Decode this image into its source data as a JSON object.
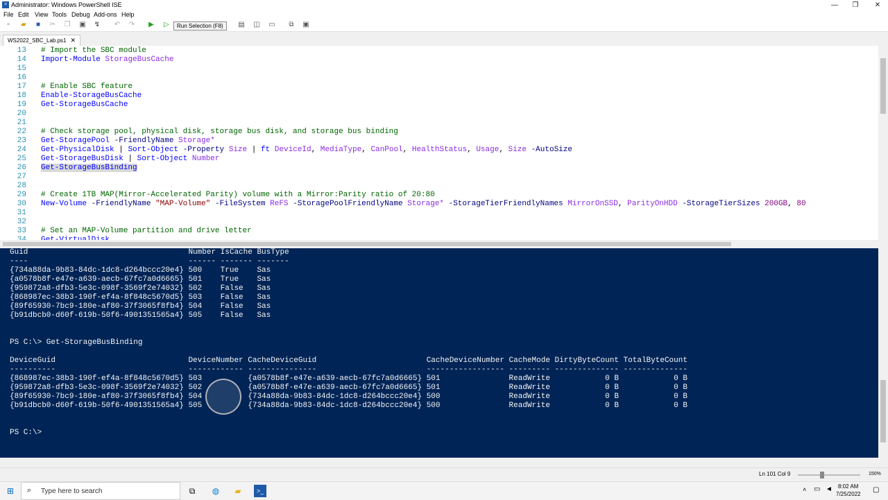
{
  "window": {
    "title": "Administrator: Windows PowerShell ISE",
    "minimize": "—",
    "restore": "❐",
    "close": "✕"
  },
  "menu": [
    "File",
    "Edit",
    "View",
    "Tools",
    "Debug",
    "Add-ons",
    "Help"
  ],
  "toolbar": {
    "tooltip": "Run Selection (F8)"
  },
  "tab": {
    "label": "WS2022_SBC_Lab.ps1",
    "close": "✕"
  },
  "editor": {
    "lines": [
      {
        "n": "13",
        "html": "<span class=\"c-com\"># Import the SBC module</span>"
      },
      {
        "n": "14",
        "html": "<span class=\"c-cmd\">Import-Module</span> <span class=\"c-arg\">StorageBusCache</span>"
      },
      {
        "n": "15",
        "html": ""
      },
      {
        "n": "16",
        "html": ""
      },
      {
        "n": "17",
        "html": "<span class=\"c-com\"># Enable SBC feature</span>"
      },
      {
        "n": "18",
        "html": "<span class=\"c-cmd\">Enable-StorageBusCache</span>"
      },
      {
        "n": "19",
        "html": "<span class=\"c-cmd\">Get-StorageBusCache</span>"
      },
      {
        "n": "20",
        "html": ""
      },
      {
        "n": "21",
        "html": ""
      },
      {
        "n": "22",
        "html": "<span class=\"c-com\"># Check storage pool, physical disk, storage bus disk, and storage bus binding</span>"
      },
      {
        "n": "23",
        "html": "<span class=\"c-cmd\">Get-StoragePool</span> <span class=\"c-par\">-FriendlyName</span> <span class=\"c-arg\">Storage*</span>"
      },
      {
        "n": "24",
        "html": "<span class=\"c-cmd\">Get-PhysicalDisk</span> <span class=\"c-plain\">|</span> <span class=\"c-cmd\">Sort-Object</span> <span class=\"c-par\">-Property</span> <span class=\"c-arg\">Size</span> <span class=\"c-plain\">|</span> <span class=\"c-cmd\">ft</span> <span class=\"c-arg\">DeviceId</span><span class=\"c-plain\">,</span> <span class=\"c-arg\">MediaType</span><span class=\"c-plain\">,</span> <span class=\"c-arg\">CanPool</span><span class=\"c-plain\">,</span> <span class=\"c-arg\">HealthStatus</span><span class=\"c-plain\">,</span> <span class=\"c-arg\">Usage</span><span class=\"c-plain\">,</span> <span class=\"c-arg\">Size</span> <span class=\"c-par\">-AutoSize</span>"
      },
      {
        "n": "25",
        "html": "<span class=\"c-cmd\">Get-StorageBusDisk</span> <span class=\"c-plain\">|</span> <span class=\"c-cmd\">Sort-Object</span> <span class=\"c-arg\">Number</span>"
      },
      {
        "n": "26",
        "html": "<span class=\"c-cmd sel\">Get-StorageBusBinding</span>"
      },
      {
        "n": "27",
        "html": ""
      },
      {
        "n": "28",
        "html": ""
      },
      {
        "n": "29",
        "html": "<span class=\"c-com\"># Create 1TB MAP(Mirror-Accelerated Parity) volume with a Mirror:Parity ratio of 20:80</span>"
      },
      {
        "n": "30",
        "html": "<span class=\"c-cmd\">New-Volume</span> <span class=\"c-par\">-FriendlyName</span> <span class=\"c-str\">\"MAP-Volume\"</span> <span class=\"c-par\">-FileSystem</span> <span class=\"c-arg\">ReFS</span> <span class=\"c-par\">-StoragePoolFriendlyName</span> <span class=\"c-arg\">Storage*</span> <span class=\"c-par\">-StorageTierFriendlyNames</span> <span class=\"c-arg\">MirrorOnSSD</span><span class=\"c-plain\">,</span> <span class=\"c-arg\">ParityOnHDD</span> <span class=\"c-par\">-StorageTierSizes</span> <span class=\"c-num\">200GB</span><span class=\"c-plain\">,</span> <span class=\"c-num\">80</span>"
      },
      {
        "n": "31",
        "html": ""
      },
      {
        "n": "32",
        "html": ""
      },
      {
        "n": "33",
        "html": "<span class=\"c-com\"># Set an MAP-Volume partition and drive letter</span>"
      },
      {
        "n": "34",
        "html": "<span class=\"c-cmd\">Get-VirtualDisk</span>"
      }
    ]
  },
  "console": {
    "lines": [
      "Guid                                   Number IsCache BusType",
      "----                                   ------ ------- -------",
      "{734a88da-9b83-84dc-1dc8-d264bccc20e4} 500    True    Sas",
      "{a0578b8f-e47e-a639-aecb-67fc7a0d6665} 501    True    Sas",
      "{959872a8-dfb3-5e3c-098f-3569f2e74032} 502    False   Sas",
      "{868987ec-38b3-190f-ef4a-8f848c5670d5} 503    False   Sas",
      "{89f65930-7bc9-180e-af80-37f3065f8fb4} 504    False   Sas",
      "{b91dbcb0-d60f-619b-50f6-4901351565a4} 505    False   Sas",
      "",
      "",
      "PS C:\\> Get-StorageBusBinding",
      "",
      "DeviceGuid                             DeviceNumber CacheDeviceGuid                        CacheDeviceNumber CacheMode DirtyByteCount TotalByteCount",
      "----------                             ------------ ---------------                        ----------------- --------- -------------- --------------",
      "{868987ec-38b3-190f-ef4a-8f848c5670d5} 503          {a0578b8f-e47e-a639-aecb-67fc7a0d6665} 501               ReadWrite            0 B            0 B",
      "{959872a8-dfb3-5e3c-098f-3569f2e74032} 502          {a0578b8f-e47e-a639-aecb-67fc7a0d6665} 501               ReadWrite            0 B            0 B",
      "{89f65930-7bc9-180e-af80-37f3065f8fb4} 504          {734a88da-9b83-84dc-1dc8-d264bccc20e4} 500               ReadWrite            0 B            0 B",
      "{b91dbcb0-d60f-619b-50f6-4901351565a4} 505          {734a88da-9b83-84dc-1dc8-d264bccc20e4} 500               ReadWrite            0 B            0 B",
      "",
      "",
      "PS C:\\>"
    ]
  },
  "status": {
    "position": "Ln 101  Col 9",
    "zoom": "150%"
  },
  "taskbar": {
    "search_placeholder": "Type here to search",
    "time": "8:02 AM",
    "date": "7/25/2022"
  },
  "colors": {
    "console_bg": "#012456",
    "console_fg": "#f5f5f5",
    "comment": "#006400",
    "cmdlet": "#0000ff",
    "parameter": "#000080",
    "argument": "#8a2be2",
    "string": "#8b0000"
  }
}
